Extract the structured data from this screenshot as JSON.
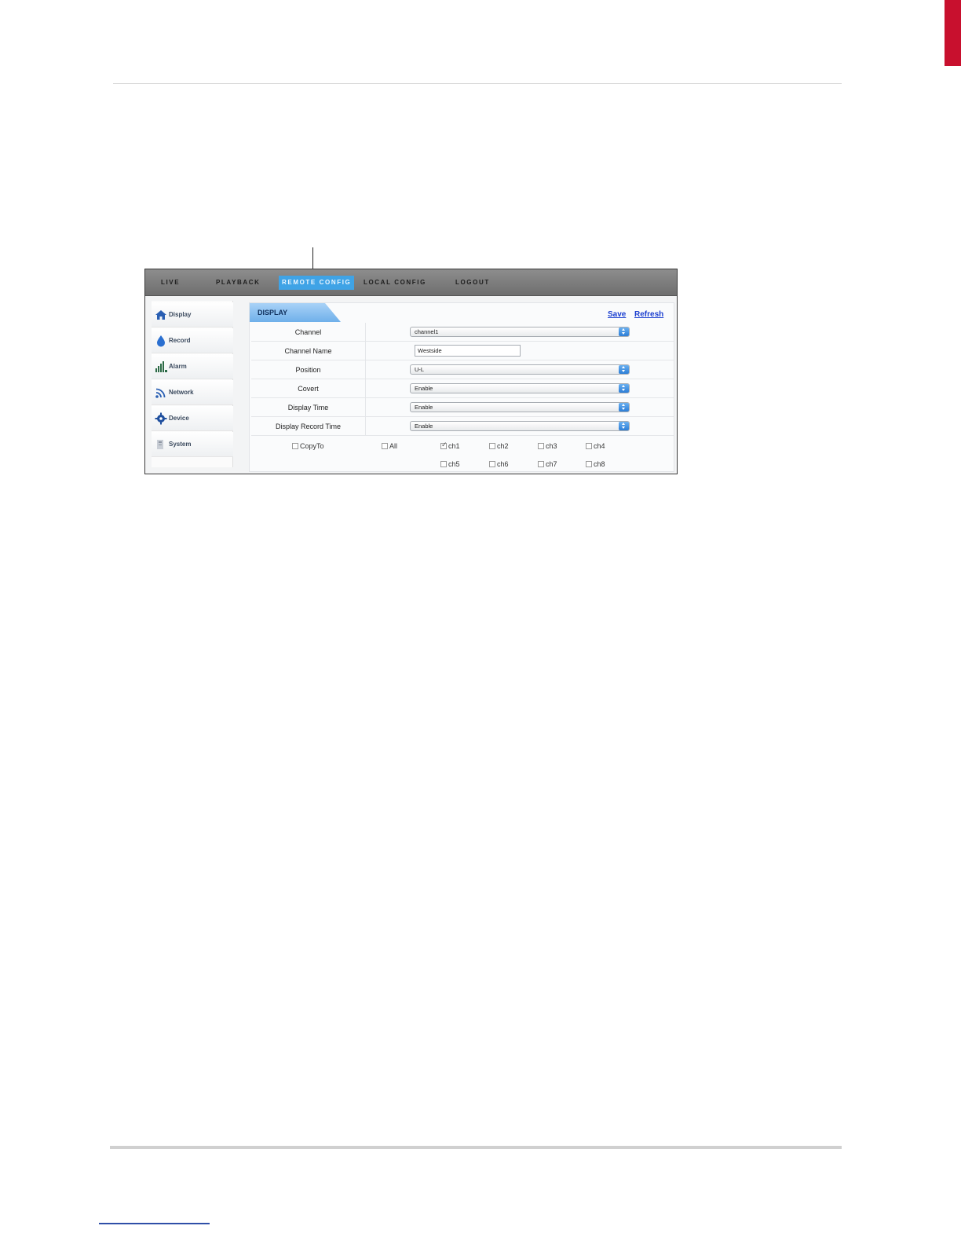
{
  "nav": {
    "items": [
      "LIVE",
      "PLAYBACK",
      "REMOTE CONFIG",
      "LOCAL CONFIG",
      "LOGOUT"
    ],
    "active": "REMOTE CONFIG"
  },
  "sidebar": {
    "items": [
      {
        "label": "Display",
        "icon": "home-icon"
      },
      {
        "label": "Record",
        "icon": "record-icon"
      },
      {
        "label": "Alarm",
        "icon": "signal-bars-icon"
      },
      {
        "label": "Network",
        "icon": "network-icon"
      },
      {
        "label": "Device",
        "icon": "gear-icon"
      },
      {
        "label": "System",
        "icon": "system-icon"
      }
    ]
  },
  "panel": {
    "title": "DISPLAY",
    "save_label": "Save",
    "refresh_label": "Refresh",
    "rows": [
      {
        "label": "Channel",
        "type": "select",
        "value": "channel1"
      },
      {
        "label": "Channel Name",
        "type": "input",
        "value": "Westside"
      },
      {
        "label": "Position",
        "type": "select",
        "value": "U-L"
      },
      {
        "label": "Covert",
        "type": "select",
        "value": "Enable"
      },
      {
        "label": "Display Time",
        "type": "select",
        "value": "Enable"
      },
      {
        "label": "Display Record Time",
        "type": "select",
        "value": "Enable"
      }
    ],
    "copy_to": {
      "label": "CopyTo",
      "all_label": "All",
      "channels": [
        {
          "label": "ch1",
          "checked": true
        },
        {
          "label": "ch2",
          "checked": false
        },
        {
          "label": "ch3",
          "checked": false
        },
        {
          "label": "ch4",
          "checked": false
        },
        {
          "label": "ch5",
          "checked": false
        },
        {
          "label": "ch6",
          "checked": false
        },
        {
          "label": "ch7",
          "checked": false
        },
        {
          "label": "ch8",
          "checked": false
        }
      ]
    }
  }
}
